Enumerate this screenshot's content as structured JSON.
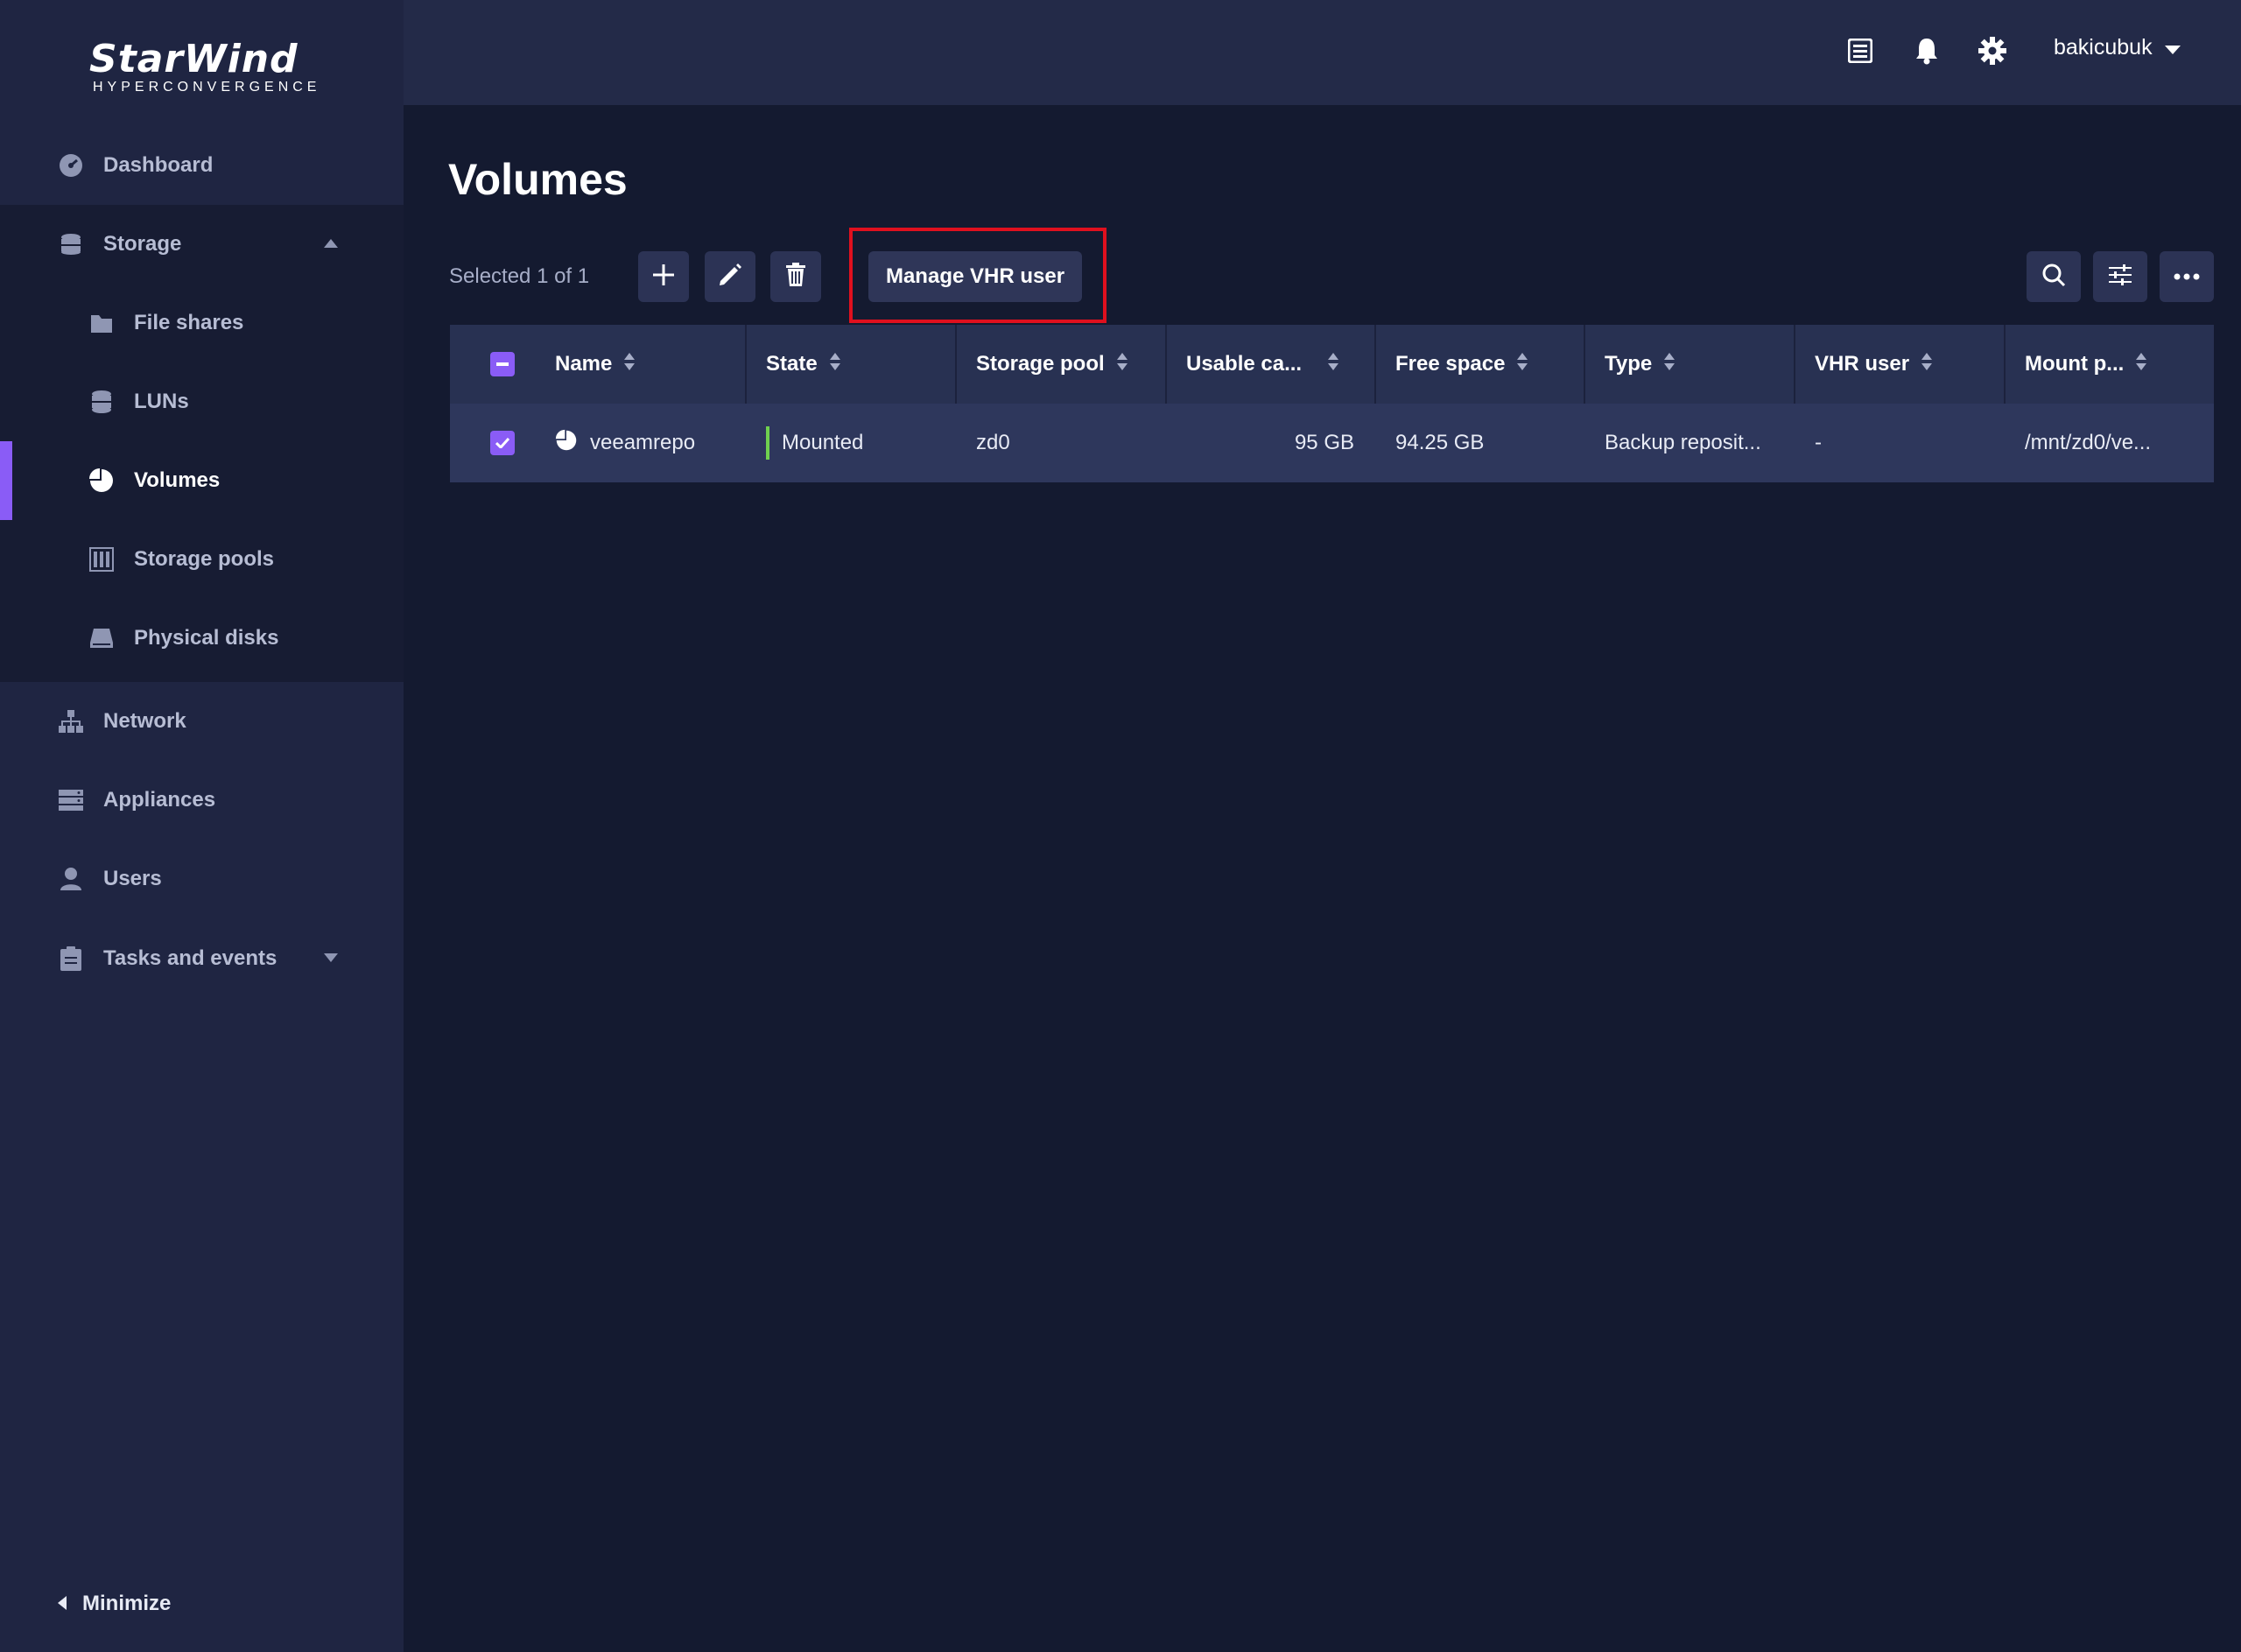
{
  "app": {
    "logo_main": "StarWind",
    "logo_sub": "HYPERCONVERGENCE"
  },
  "header": {
    "username": "bakicubuk",
    "icons": [
      "list-icon",
      "bell-icon",
      "gear-icon"
    ]
  },
  "sidebar": {
    "items": [
      {
        "label": "Dashboard",
        "icon": "dashboard-icon"
      },
      {
        "label": "Storage",
        "icon": "storage-icon",
        "expanded": true
      },
      {
        "label": "File shares",
        "icon": "folder-icon"
      },
      {
        "label": "LUNs",
        "icon": "database-icon"
      },
      {
        "label": "Volumes",
        "icon": "pie-icon",
        "active": true
      },
      {
        "label": "Storage pools",
        "icon": "pool-icon"
      },
      {
        "label": "Physical disks",
        "icon": "disk-icon"
      },
      {
        "label": "Network",
        "icon": "network-icon"
      },
      {
        "label": "Appliances",
        "icon": "server-icon"
      },
      {
        "label": "Users",
        "icon": "user-icon"
      },
      {
        "label": "Tasks and events",
        "icon": "clipboard-icon",
        "expanded": false
      }
    ],
    "minimize_label": "Minimize"
  },
  "page": {
    "title": "Volumes"
  },
  "toolbar": {
    "selected_text": "Selected 1 of 1",
    "manage_vhr_label": "Manage VHR user"
  },
  "table": {
    "columns": [
      "Name",
      "State",
      "Storage pool",
      "Usable ca...",
      "Free space",
      "Type",
      "VHR user",
      "Mount p..."
    ],
    "rows": [
      {
        "name": "veeamrepo",
        "state": "Mounted",
        "storage_pool": "zd0",
        "usable_capacity": "95 GB",
        "free_space": "94.25 GB",
        "type": "Backup reposit...",
        "vhr_user": "-",
        "mount_point": "/mnt/zd0/ve..."
      }
    ]
  },
  "colors": {
    "accent": "#8a5cf6",
    "highlight": "#e0101e",
    "mounted": "#6fd04f"
  }
}
